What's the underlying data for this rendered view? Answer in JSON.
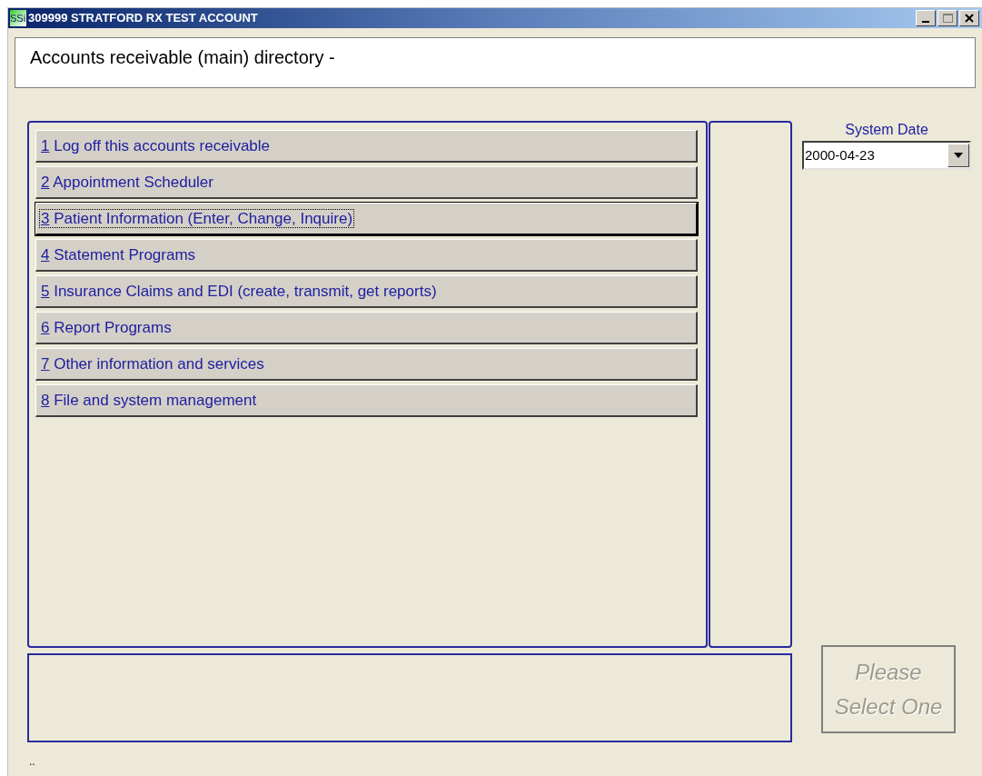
{
  "window": {
    "icon_text": "SSi",
    "title": "309999 STRATFORD RX TEST ACCOUNT"
  },
  "header": {
    "title": "Accounts receivable (main) directory -"
  },
  "menu": [
    {
      "key": "1",
      "label": " Log off this accounts receivable",
      "selected": false
    },
    {
      "key": "2",
      "label": " Appointment Scheduler",
      "selected": false
    },
    {
      "key": "3",
      "label": " Patient Information (Enter, Change, Inquire)",
      "selected": true
    },
    {
      "key": "4",
      "label": " Statement Programs",
      "selected": false
    },
    {
      "key": "5",
      "label": " Insurance Claims and EDI (create, transmit, get reports)",
      "selected": false
    },
    {
      "key": "6",
      "label": " Report Programs",
      "selected": false
    },
    {
      "key": "7",
      "label": " Other information and services",
      "selected": false
    },
    {
      "key": "8",
      "label": " File and system management",
      "selected": false
    }
  ],
  "system_date": {
    "label": "System Date",
    "value": "2000-04-23"
  },
  "select_button": {
    "label": "Please Select One",
    "disabled": true
  },
  "status_bar": {
    "text": ".."
  }
}
